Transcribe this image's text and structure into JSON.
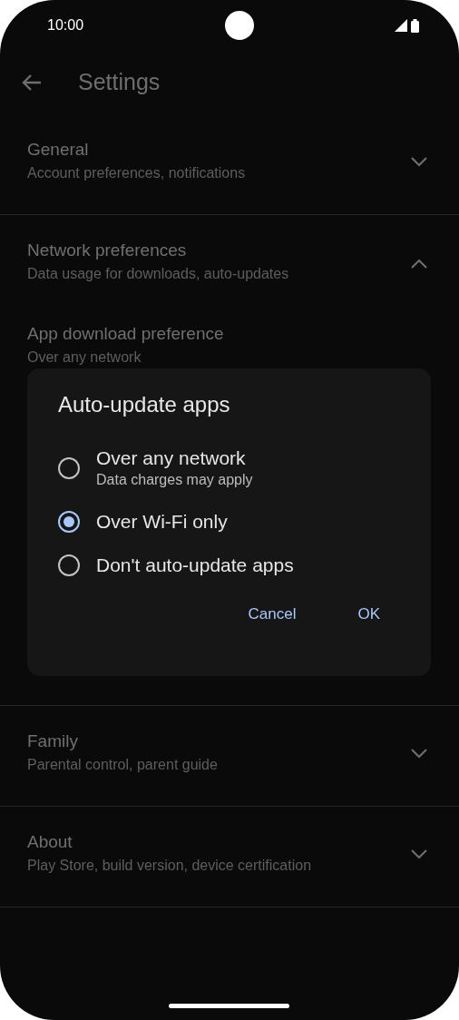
{
  "status_bar": {
    "time": "10:00"
  },
  "app_bar": {
    "title": "Settings"
  },
  "sections": [
    {
      "title": "General",
      "subtitle": "Account preferences, notifications",
      "expanded": false
    },
    {
      "title": "Network preferences",
      "subtitle": "Data usage for downloads, auto-updates",
      "expanded": true,
      "children": [
        {
          "title": "App download preference",
          "value": "Over any network"
        }
      ]
    },
    {
      "title": "Family",
      "subtitle": "Parental control, parent guide",
      "expanded": false
    },
    {
      "title": "About",
      "subtitle": "Play Store, build version, device certification",
      "expanded": false
    }
  ],
  "dialog": {
    "title": "Auto-update apps",
    "options": [
      {
        "label": "Over any network",
        "description": "Data charges may apply",
        "selected": false
      },
      {
        "label": "Over Wi-Fi only",
        "selected": true
      },
      {
        "label": "Don't auto-update apps",
        "selected": false
      }
    ],
    "buttons": [
      "Cancel",
      "OK"
    ]
  }
}
